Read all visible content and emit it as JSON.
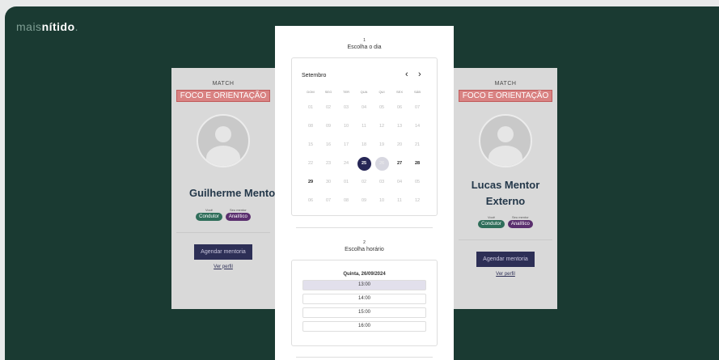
{
  "brand": {
    "prefix": "mais",
    "strong": "nítido",
    "suffix": "."
  },
  "cards": [
    {
      "match": "MATCH",
      "focus": "FOCO E ORIENTAÇÃO",
      "name": "Guilherme Mentor",
      "role_you_caption": "Você",
      "role_you": "Condutor",
      "role_mentor_caption": "Seu mentor",
      "role_mentor": "Analítico",
      "button": "Agendar mentoria",
      "link": "Ver perfil"
    },
    {
      "match": "MATCH",
      "focus": "FOCO E ORIENTAÇÃO",
      "name": "Lucas Mentor Externo",
      "role_you_caption": "Você",
      "role_you": "Condutor",
      "role_mentor_caption": "Seu mentor",
      "role_mentor": "Analítico",
      "button": "Agendar mentoria",
      "link": "Ver perfil"
    }
  ],
  "modal": {
    "step1": {
      "num": "1",
      "title": "Escolha o dia"
    },
    "calendar": {
      "month": "Setembro",
      "prev_icon": "chevron-left-icon",
      "next_icon": "chevron-right-icon",
      "weekdays": [
        "DOM",
        "SEG",
        "TER",
        "QUA",
        "QUI",
        "SEX",
        "SÁB"
      ],
      "days": [
        [
          "01",
          "02",
          "03",
          "04",
          "05",
          "06",
          "07"
        ],
        [
          "08",
          "09",
          "10",
          "11",
          "12",
          "13",
          "14"
        ],
        [
          "15",
          "16",
          "17",
          "18",
          "19",
          "20",
          "21"
        ],
        [
          "22",
          "23",
          "24",
          "25",
          "26",
          "27",
          "28"
        ],
        [
          "29",
          "30",
          "01",
          "02",
          "03",
          "04",
          "05"
        ],
        [
          "06",
          "07",
          "08",
          "09",
          "10",
          "11",
          "12"
        ]
      ],
      "available": [
        "25",
        "27",
        "28",
        "29"
      ],
      "selected": "25",
      "highlighted": "26"
    },
    "step2": {
      "num": "2",
      "title": "Escolha horário"
    },
    "hours": {
      "date": "Quinta, 26/09/2024",
      "slots": [
        "13:00",
        "14:00",
        "15:00",
        "16:00"
      ],
      "active": "13:00"
    }
  }
}
